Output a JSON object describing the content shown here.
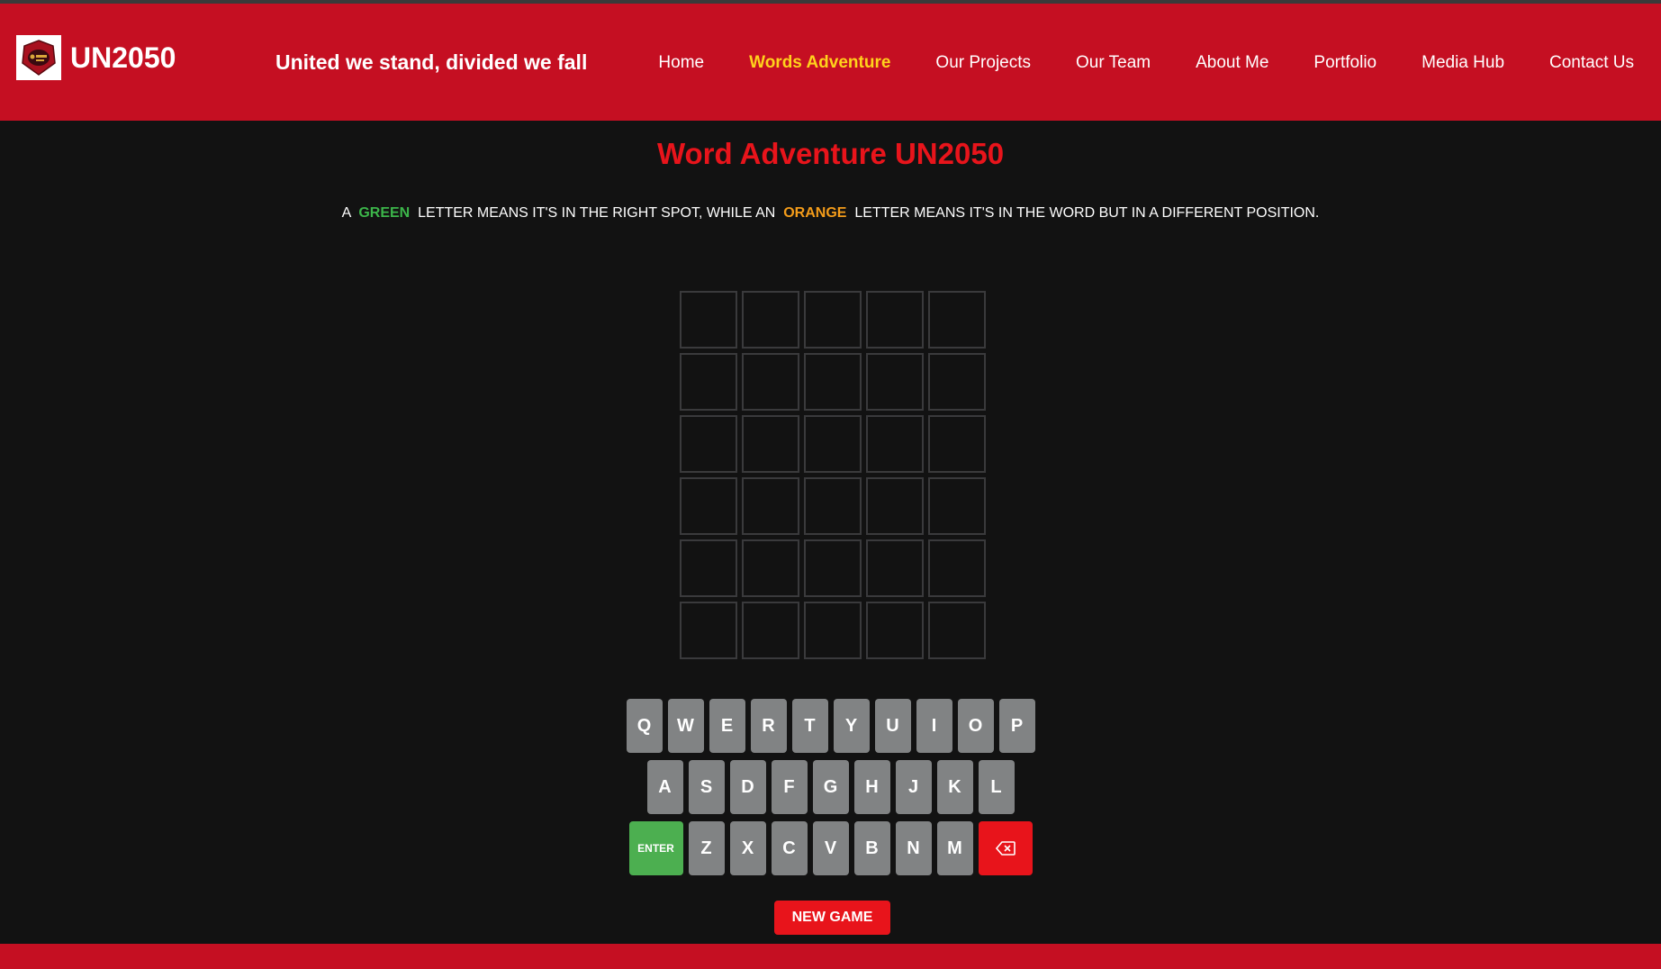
{
  "brand": {
    "name": "UN2050",
    "motto": "United we stand, divided we fall",
    "logo_icon": "un2050-crest-icon"
  },
  "nav": [
    {
      "label": "Home",
      "active": false
    },
    {
      "label": "Words Adventure",
      "active": true
    },
    {
      "label": "Our Projects",
      "active": false
    },
    {
      "label": "Our Team",
      "active": false
    },
    {
      "label": "About Me",
      "active": false
    },
    {
      "label": "Portfolio",
      "active": false
    },
    {
      "label": "Media Hub",
      "active": false
    },
    {
      "label": "Contact Us",
      "active": false
    }
  ],
  "game": {
    "title": "Word Adventure UN2050",
    "rules": {
      "prefix": "A ",
      "green_word": "GREEN",
      "middle": " LETTER MEANS IT'S IN THE RIGHT SPOT, WHILE AN ",
      "orange_word": "ORANGE",
      "suffix": " LETTER MEANS IT'S IN THE WORD BUT IN A DIFFERENT POSITION."
    },
    "board": {
      "rows": [
        [
          "",
          "",
          "",
          "",
          ""
        ],
        [
          "",
          "",
          "",
          "",
          ""
        ],
        [
          "",
          "",
          "",
          "",
          ""
        ],
        [
          "",
          "",
          "",
          "",
          ""
        ],
        [
          "",
          "",
          "",
          "",
          ""
        ],
        [
          "",
          "",
          "",
          "",
          ""
        ]
      ]
    },
    "keyboard": {
      "rows": [
        [
          "Q",
          "W",
          "E",
          "R",
          "T",
          "Y",
          "U",
          "I",
          "O",
          "P"
        ],
        [
          "A",
          "S",
          "D",
          "F",
          "G",
          "H",
          "J",
          "K",
          "L"
        ],
        [
          "ENTER",
          "Z",
          "X",
          "C",
          "V",
          "B",
          "N",
          "M",
          "BACKSPACE"
        ]
      ],
      "enter_label": "ENTER",
      "backspace_icon": "backspace-icon"
    },
    "new_game_label": "NEW GAME"
  },
  "colors": {
    "header": "#c50f22",
    "background": "#121212",
    "accent_red": "#e8141b",
    "active_nav": "#ffd21c",
    "green": "#4caf50",
    "orange": "#f39c1a",
    "key_gray": "#818384"
  }
}
